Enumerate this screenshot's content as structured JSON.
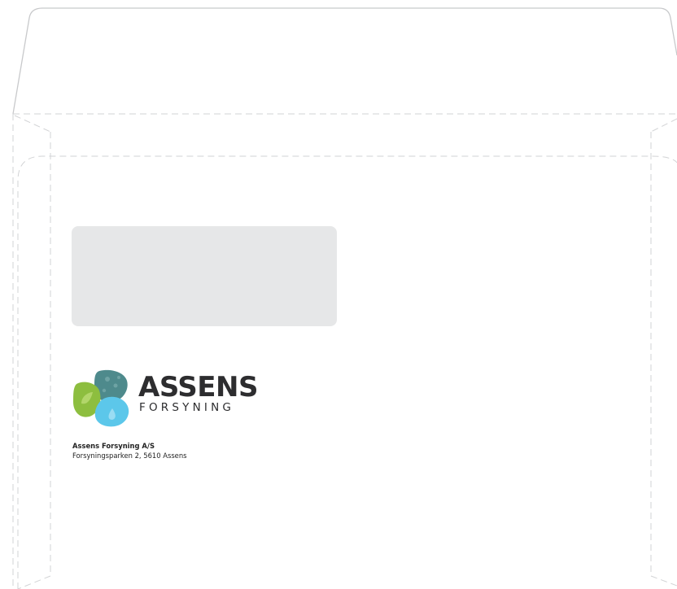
{
  "logo": {
    "wordmark": "ASSENS",
    "submark": "FORSYNING",
    "colors": {
      "green": "#8dbe3f",
      "teal": "#4e8a8c",
      "blue": "#5cc7ea",
      "text": "#2d2d2f"
    }
  },
  "sender": {
    "name": "Assens Forsyning A/S",
    "address": "Forsyningsparken 2, 5610 Assens"
  },
  "colors": {
    "window_fill": "#e6e7e8",
    "envelope_outline": "#c8c9cb",
    "fold_guides": "#cfd0d2"
  }
}
